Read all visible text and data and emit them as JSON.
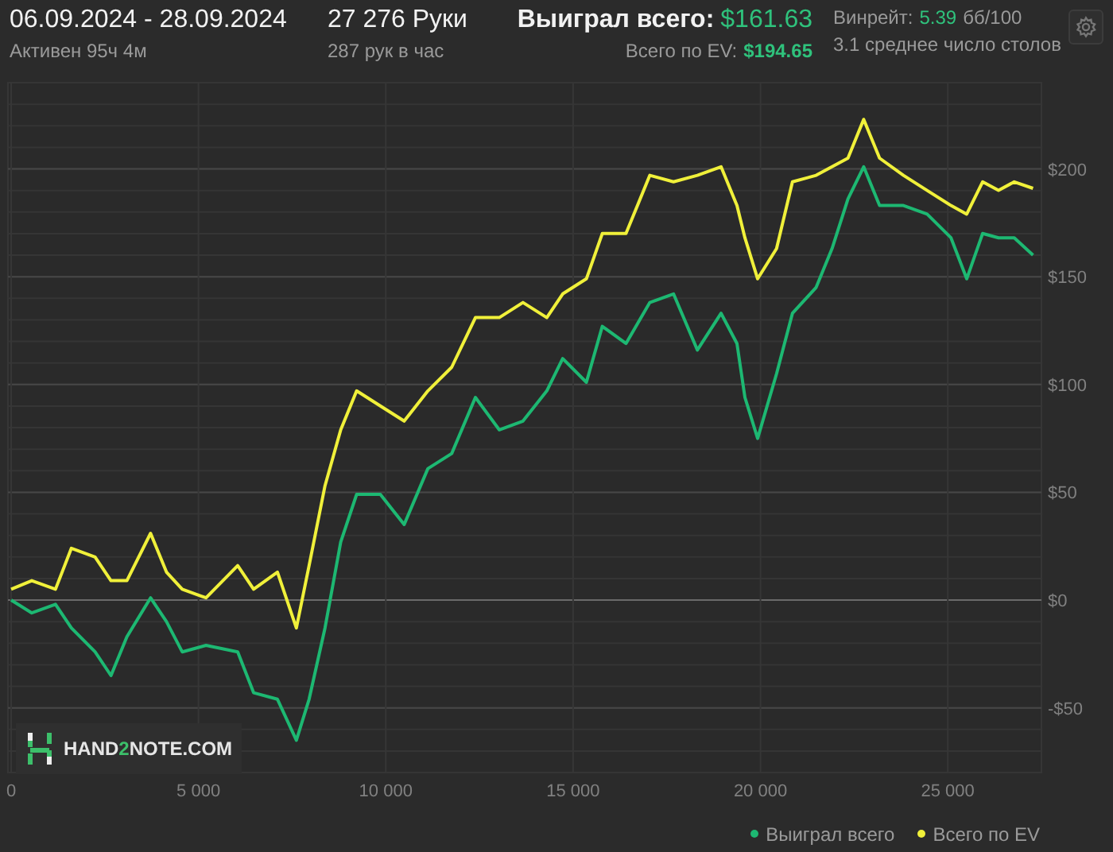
{
  "header": {
    "period": "06.09.2024 - 28.09.2024",
    "active": "Активен 95ч 4м",
    "hands": "27 276 Руки",
    "hands_per_hour": "287 рук в час",
    "won_label": "Выиграл всего:",
    "won_value": "$161.63",
    "ev_label": "Всего по EV:",
    "ev_value": "$194.65",
    "winrate_label": "Винрейт:",
    "winrate_value": "5.39",
    "winrate_unit": "бб/100",
    "tables": "3.1 среднее число столов"
  },
  "logo": {
    "before": "HAND",
    "accent": "2",
    "after": "NOTE.COM"
  },
  "chart_data": {
    "type": "line",
    "grid": true,
    "xlim": [
      0,
      27500
    ],
    "ylim": [
      -80,
      240
    ],
    "xticks": [
      {
        "value": 0,
        "label": "0"
      },
      {
        "value": 5000,
        "label": "5 000"
      },
      {
        "value": 10000,
        "label": "10 000"
      },
      {
        "value": 15000,
        "label": "15 000"
      },
      {
        "value": 20000,
        "label": "20 000"
      },
      {
        "value": 25000,
        "label": "25 000"
      }
    ],
    "yticks": [
      {
        "value": -50,
        "label": "-$50"
      },
      {
        "value": 0,
        "label": "$0"
      },
      {
        "value": 50,
        "label": "$50"
      },
      {
        "value": 100,
        "label": "$100"
      },
      {
        "value": 150,
        "label": "$150"
      },
      {
        "value": 200,
        "label": "$200"
      }
    ],
    "x": [
      0,
      550,
      1184,
      1607,
      2242,
      2665,
      3088,
      3723,
      4145,
      4568,
      5203,
      6049,
      6472,
      7107,
      7614,
      7953,
      8376,
      8799,
      9222,
      9856,
      10490,
      11125,
      11760,
      12394,
      13029,
      13663,
      14298,
      14721,
      15355,
      15779,
      16413,
      17048,
      17681,
      18316,
      18950,
      19373,
      19585,
      19923,
      20431,
      20854,
      21488,
      21911,
      22334,
      22757,
      23180,
      23815,
      24449,
      25084,
      25507,
      25930,
      26353,
      26776,
      27276
    ],
    "series": [
      {
        "name": "Выиграл всего",
        "color": "#1db872",
        "values": [
          0,
          -6,
          -2,
          -13,
          -24,
          -35,
          -17,
          1,
          -10,
          -24,
          -21,
          -24,
          -43,
          -46,
          -65,
          -46,
          -13,
          27,
          49,
          49,
          35,
          61,
          68,
          94,
          79,
          83,
          97,
          112,
          101,
          127,
          119,
          138,
          142,
          116,
          133,
          119,
          94,
          75,
          105,
          133,
          145,
          163,
          186,
          201,
          183,
          183,
          179,
          168,
          149,
          170,
          168,
          168,
          160
        ]
      },
      {
        "name": "Всего по EV",
        "color": "#f0f03a",
        "values": [
          5,
          9,
          5,
          24,
          20,
          9,
          9,
          31,
          13,
          5,
          1,
          16,
          5,
          13,
          -13,
          16,
          53,
          79,
          97,
          90,
          83,
          97,
          108,
          131,
          131,
          138,
          131,
          142,
          149,
          170,
          170,
          197,
          194,
          197,
          201,
          183,
          168,
          149,
          163,
          194,
          197,
          201,
          205,
          223,
          205,
          197,
          190,
          183,
          179,
          194,
          190,
          194,
          191
        ]
      }
    ]
  }
}
